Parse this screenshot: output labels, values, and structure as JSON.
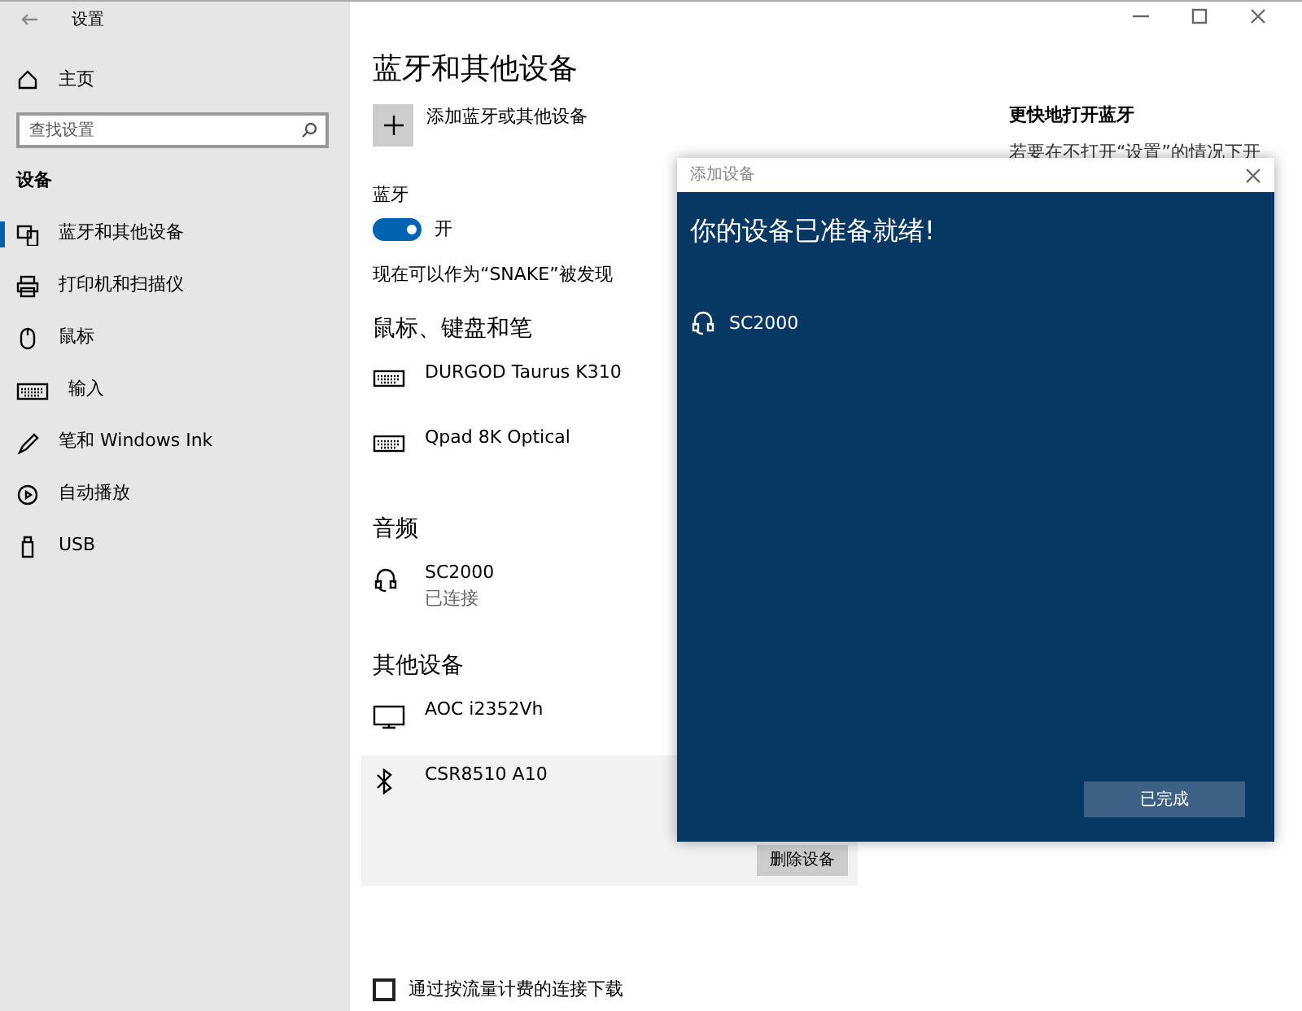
{
  "window": {
    "title": "设置"
  },
  "sidebar": {
    "home": "主页",
    "search": {
      "placeholder": "查找设置"
    },
    "section": "设备",
    "items": [
      {
        "label": "蓝牙和其他设备",
        "kind": "devices",
        "selected": true
      },
      {
        "label": "打印机和扫描仪",
        "kind": "printer",
        "selected": false
      },
      {
        "label": "鼠标",
        "kind": "mouse",
        "selected": false
      },
      {
        "label": "输入",
        "kind": "keyboard",
        "selected": false
      },
      {
        "label": "笔和 Windows Ink",
        "kind": "pen",
        "selected": false
      },
      {
        "label": "自动播放",
        "kind": "autoplay",
        "selected": false
      },
      {
        "label": "USB",
        "kind": "usb",
        "selected": false
      }
    ]
  },
  "main": {
    "title": "蓝牙和其他设备",
    "add_device": "添加蓝牙或其他设备",
    "bluetooth": {
      "label": "蓝牙",
      "on": true,
      "state_text": "开"
    },
    "discoverable": "现在可以作为“SNAKE”被发现",
    "groups": [
      {
        "heading": "鼠标、键盘和笔",
        "devices": [
          {
            "name": "DURGOD Taurus K310",
            "kind": "keyboard",
            "selected": false
          },
          {
            "name": "Qpad 8K Optical",
            "kind": "keyboard",
            "selected": false
          }
        ]
      },
      {
        "heading": "音频",
        "devices": [
          {
            "name": "SC2000",
            "status": "已连接",
            "kind": "headset",
            "selected": false
          }
        ]
      },
      {
        "heading": "其他设备",
        "devices": [
          {
            "name": "AOC i2352Vh",
            "kind": "monitor",
            "selected": false
          },
          {
            "name": "CSR8510 A10",
            "kind": "bluetooth",
            "selected": true,
            "action": "删除设备"
          }
        ]
      }
    ],
    "metered": {
      "label": "通过按流量计费的连接下载",
      "checked": false
    }
  },
  "related": {
    "heading": "更快地打开蓝牙",
    "text": "若要在不打开“设置”的情况下开"
  },
  "dialog": {
    "title": "添加设备",
    "heading": "你的设备已准备就绪!",
    "device": {
      "name": "SC2000",
      "kind": "headset"
    },
    "button": "已完成"
  }
}
